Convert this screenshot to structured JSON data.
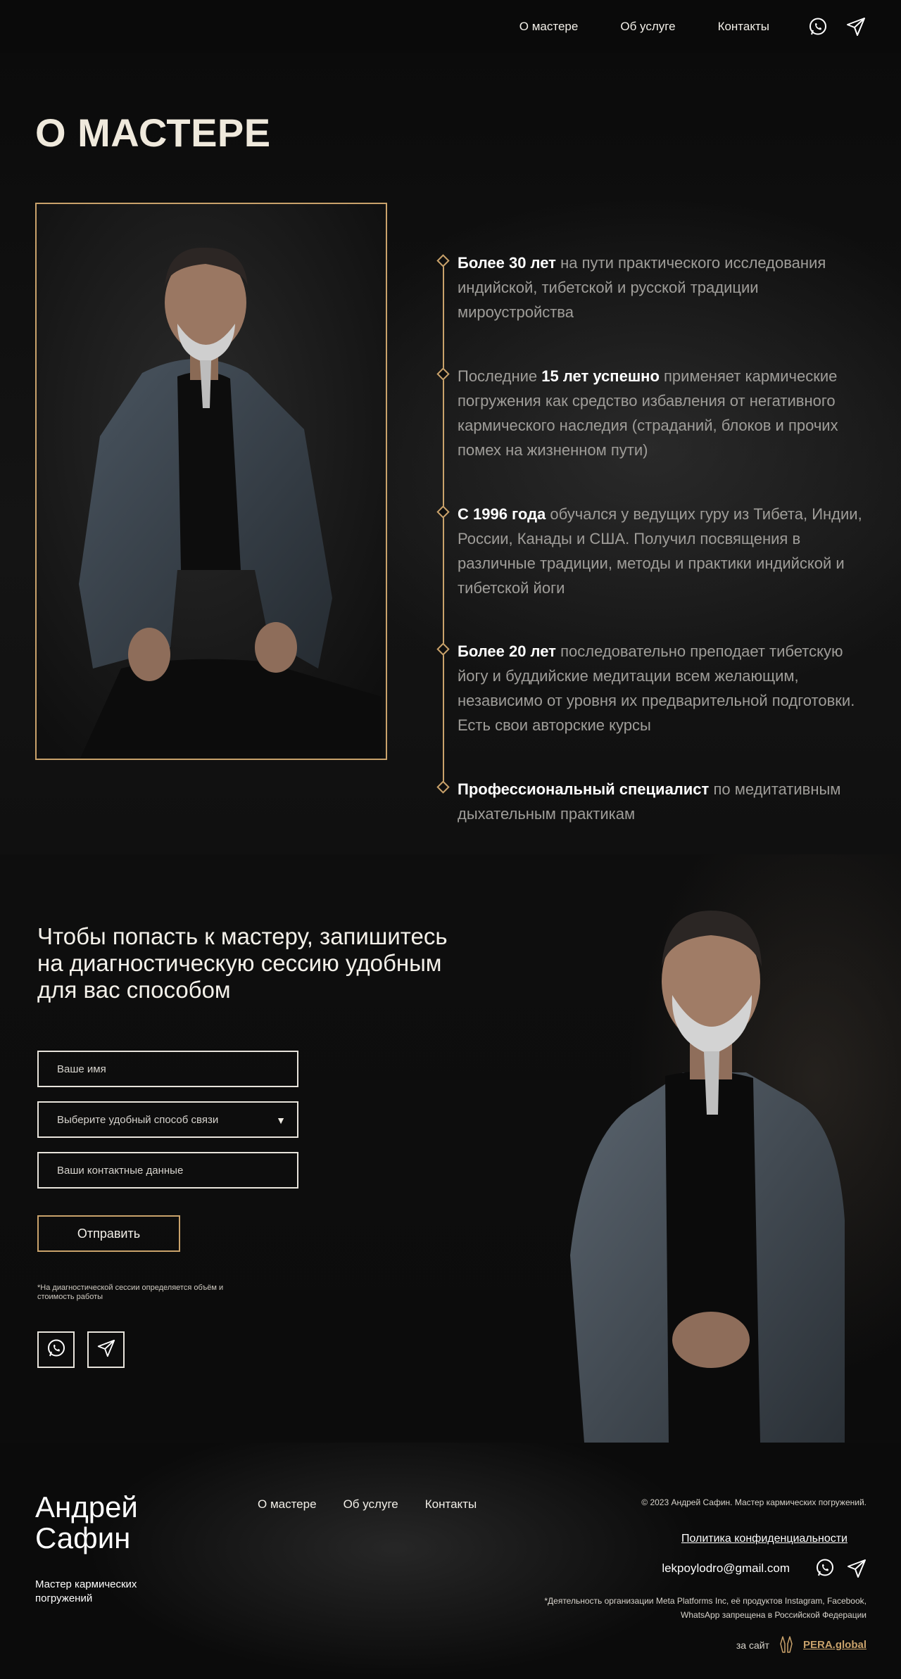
{
  "header": {
    "nav": [
      "О мастере",
      "Об услуге",
      "Контакты"
    ]
  },
  "about": {
    "title": "О МАСТЕРЕ",
    "items": [
      {
        "bold": "Более 30 лет",
        "text": " на пути практического исследования индийской, тибетской и русской традиции мироустройства"
      },
      {
        "lead": "Последние ",
        "bold": "15 лет успешно",
        "text": " применяет кармические погружения как средство избавления от негативного кармического наследия (страданий, блоков и прочих помех на жизненном пути)"
      },
      {
        "bold": " С 1996 года",
        "text": " обучался у ведущих гуру из Тибета, Индии, России, Канады и США. Получил посвящения в различные традиции, методы и практики индийской и тибетской йоги"
      },
      {
        "bold": "Более 20 лет",
        "text": " последовательно преподает тибетскую йогу и буддийские медитации всем желающим, независимо от уровня их предварительной подготовки. Есть свои авторские курсы"
      },
      {
        "bold": " Профессиональный специалист",
        "text": " по медитативным дыхательным практикам"
      }
    ]
  },
  "contact": {
    "heading": "Чтобы попасть к мастеру, запишитесь на диагностическую сессию удобным для вас способом",
    "name_placeholder": "Ваше имя",
    "method_placeholder": "Выберите удобный способ связи",
    "contacts_placeholder": "Ваши контактные данные",
    "submit": "Отправить",
    "note": "*На диагностической сессии определяется объём и стоимость работы"
  },
  "footer": {
    "name": "Андрей Сафин",
    "subtitle": "Мастер кармических погружений",
    "nav": [
      "О мастере",
      "Об услуге",
      "Контакты"
    ],
    "copyright": "© 2023 Андрей Сафин. Мастер кармических погружений.",
    "policy": "Политика конфиденциальности",
    "email": "lekpoylodro@gmail.com",
    "legal": "*Деятельность организации Meta Platforms Inc, её продуктов Instagram, Facebook, WhatsApp запрещена в Российской Федерации",
    "credit_prefix": "за сайт",
    "credit_brand": "PERA.global"
  },
  "colors": {
    "accent": "#c9a26b",
    "background": "#0b0b0b",
    "text": "#efe9dc"
  },
  "icons": [
    "whatsapp-icon",
    "telegram-icon"
  ]
}
